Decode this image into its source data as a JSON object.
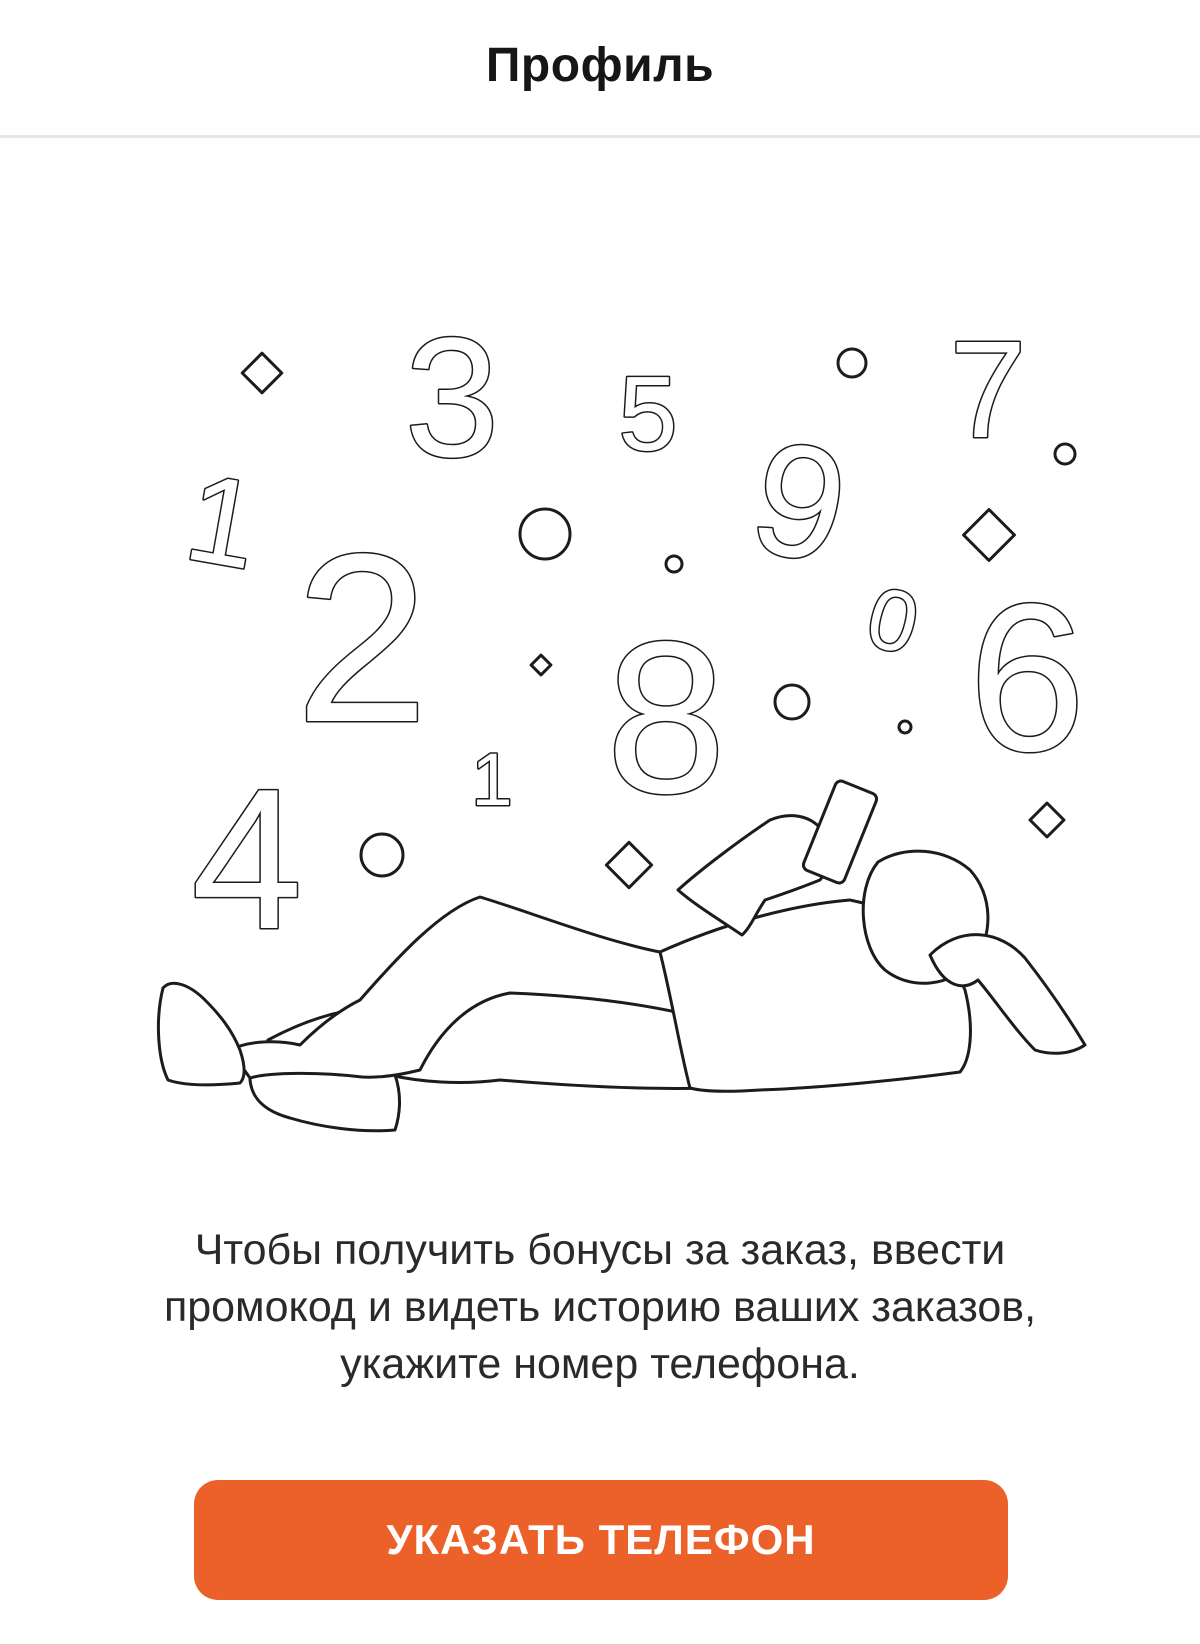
{
  "header": {
    "title": "Профиль"
  },
  "illustration": {
    "subject": "person-lying-with-phone",
    "digits": [
      "3",
      "5",
      "7",
      "1",
      "2",
      "9",
      "0",
      "6",
      "8",
      "1",
      "4"
    ]
  },
  "message": {
    "lines": [
      "Чтобы получить бонусы за заказ, ввести",
      "промокод и видеть историю ваших заказов,",
      "укажите номер телефона."
    ]
  },
  "cta": {
    "label": "УКАЗАТЬ ТЕЛЕФОН"
  },
  "colors": {
    "accent": "#ec6129",
    "text": "#1a1a1a",
    "divider": "#e6e6e6",
    "background": "#ffffff"
  }
}
